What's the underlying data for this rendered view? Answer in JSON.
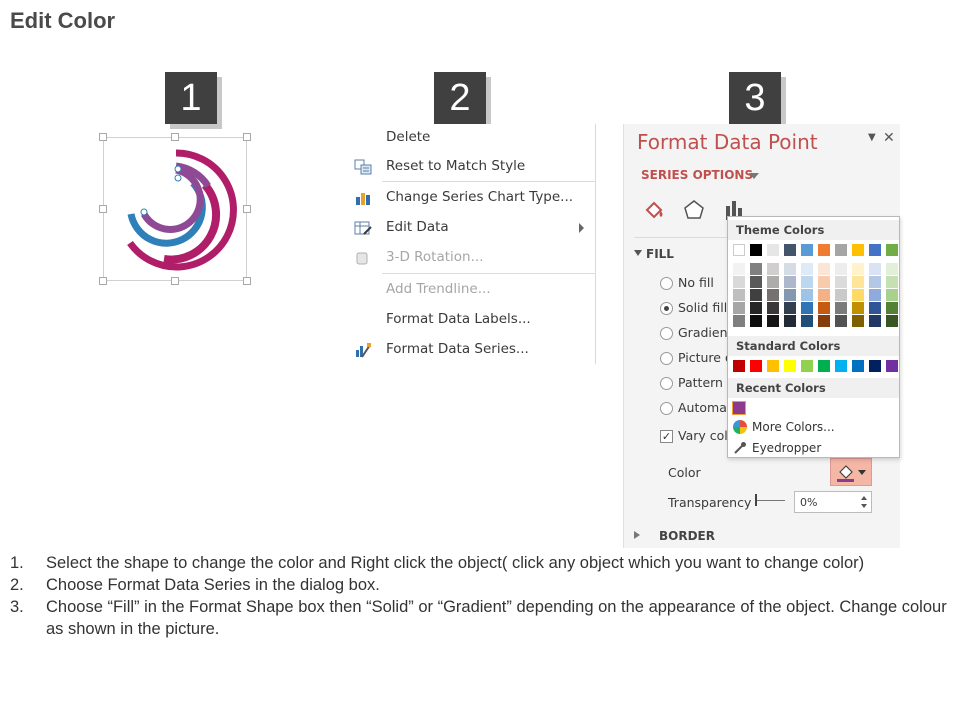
{
  "page": {
    "title": "Edit Color"
  },
  "badges": [
    "1",
    "2",
    "3"
  ],
  "context_menu": {
    "items": [
      {
        "label": "Delete",
        "icon": "none",
        "disabled": false
      },
      {
        "label": "Reset to Match Style",
        "icon": "reset-style-icon",
        "disabled": false
      },
      {
        "label": "Change Series Chart Type...",
        "icon": "bar-chart-icon",
        "disabled": false
      },
      {
        "label": "Edit Data",
        "icon": "edit-data-icon",
        "disabled": false,
        "submenu": true
      },
      {
        "label": "3-D Rotation...",
        "icon": "3d-rotation-icon",
        "disabled": true
      },
      {
        "label": "Add Trendline...",
        "icon": "none",
        "disabled": true
      },
      {
        "label": "Format Data Labels...",
        "icon": "none",
        "disabled": false
      },
      {
        "label": "Format Data Series...",
        "icon": "format-series-icon",
        "disabled": false
      }
    ]
  },
  "format_pane": {
    "title": "Format Data Point",
    "series_options": "SERIES OPTIONS",
    "fill_section": "FILL",
    "fill_options": [
      "No fill",
      "Solid fill",
      "Gradient",
      "Picture o",
      "Pattern fi",
      "Automat"
    ],
    "selected_fill": "Solid fill",
    "vary_colors": "Vary colo",
    "color_label": "Color",
    "transparency_label": "Transparency",
    "transparency_value": "0%",
    "border_section": "BORDER"
  },
  "color_picker": {
    "theme_colors_label": "Theme Colors",
    "standard_colors_label": "Standard Colors",
    "recent_colors_label": "Recent Colors",
    "more_colors": "More Colors...",
    "eyedropper": "Eyedropper",
    "theme_top": [
      "#ffffff",
      "#000000",
      "#e7e6e6",
      "#44546a",
      "#5b9bd5",
      "#ed7d31",
      "#a5a5a5",
      "#ffc000",
      "#4472c4",
      "#70ad47"
    ],
    "theme_shades": [
      [
        "#f2f2f2",
        "#808080",
        "#d0cece",
        "#d6dce4",
        "#deebf6",
        "#fbe5d6",
        "#ededed",
        "#fff2cc",
        "#dae3f3",
        "#e2efd9"
      ],
      [
        "#d9d9d9",
        "#595959",
        "#aeabab",
        "#adb9ca",
        "#bdd7ee",
        "#f8cbad",
        "#dbdbdb",
        "#ffe599",
        "#b4c7e7",
        "#c5e0b3"
      ],
      [
        "#bfbfbf",
        "#404040",
        "#767171",
        "#8497b0",
        "#9dc3e6",
        "#f4b183",
        "#c9c9c9",
        "#ffd966",
        "#8faadc",
        "#a9d18e"
      ],
      [
        "#a6a6a6",
        "#262626",
        "#3a3838",
        "#323f4f",
        "#2e75b6",
        "#c55a11",
        "#7b7b7b",
        "#bf9000",
        "#2f5597",
        "#538135"
      ],
      [
        "#7f7f7f",
        "#0d0d0d",
        "#171616",
        "#222a35",
        "#1f4e79",
        "#843c0c",
        "#525252",
        "#7f6000",
        "#1f3864",
        "#375623"
      ]
    ],
    "standard": [
      "#c00000",
      "#ff0000",
      "#ffc000",
      "#ffff00",
      "#92d050",
      "#00b050",
      "#00b0f0",
      "#0070c0",
      "#002060",
      "#7030a0"
    ],
    "recent": [
      "#8e3a8e"
    ]
  },
  "instructions": [
    {
      "num": "1.",
      "text": "Select the shape to change the color and Right click the object( click any object which you want to change color)"
    },
    {
      "num": "2.",
      "text": "Choose Format Data Series in the dialog box."
    },
    {
      "num": "3.",
      "text": "Choose “Fill” in the Format Shape box then “Solid” or “Gradient” depending on the appearance of the object. Change colour as shown in the picture."
    }
  ],
  "colors": {
    "accent": "#c0504d",
    "arc_magenta": "#b01e6a",
    "arc_blue": "#2f7fb8",
    "arc_purple": "#8e4a94"
  }
}
